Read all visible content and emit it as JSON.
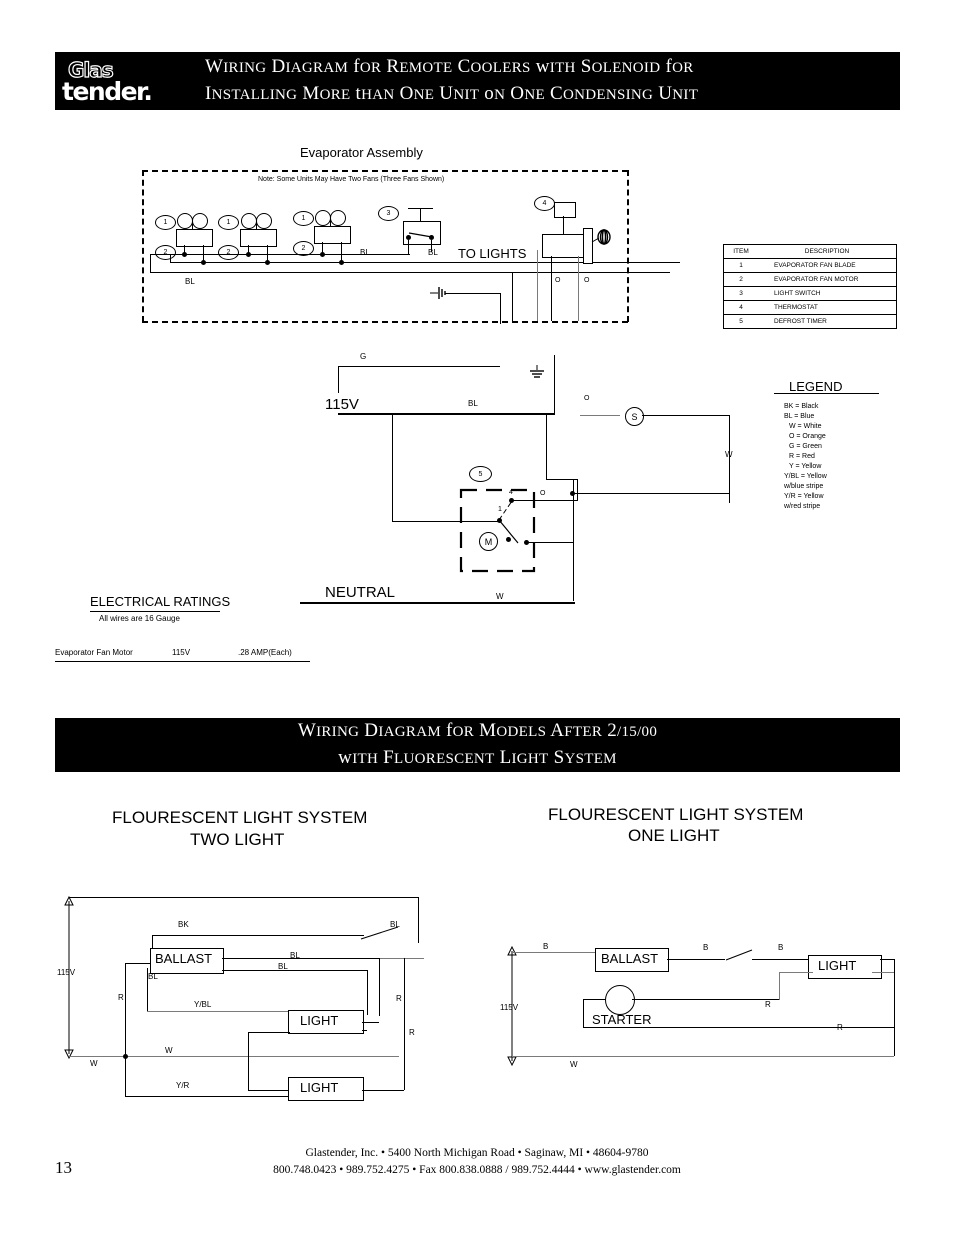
{
  "page": {
    "number": "13"
  },
  "header": {
    "logo_top": "Glas",
    "logo_bottom": "tender.",
    "title_line1": "Wiring Diagram for Remote Coolers with Solenoid for",
    "title_line2": "Installing More than One Unit on One Condensing Unit"
  },
  "banner2": {
    "title_line1": "Wiring Diagram for Models After 2/15/00",
    "title_line2": "with Fluorescent Light System"
  },
  "evaporator": {
    "title": "Evaporator Assembly",
    "note": "Note: Some Units May Have Two Fans (Three Fans Shown)",
    "fan_callouts": [
      "1",
      "2",
      "1",
      "2",
      "1",
      "2"
    ],
    "switch_callout": "3",
    "thermostat_callout": "4",
    "timer_callout": "5",
    "labels": {
      "bl_switch_left": "BL",
      "bl_switch_right": "BL",
      "to_lights": "TO LIGHTS",
      "bl_bus": "BL",
      "o_left": "O",
      "o_right": "O",
      "g_ground": "G",
      "bl_main": "BL",
      "o_mid": "O",
      "o_timer": "O",
      "w_right": "W",
      "w_neutral": "W",
      "supply_115v": "115V",
      "neutral": "NEUTRAL",
      "solenoid": "S",
      "timer_motor": "M",
      "timer_term_1": "1",
      "timer_term_4": "4"
    }
  },
  "item_table": {
    "headers": [
      "ITEM",
      "DESCRIPTION"
    ],
    "rows": [
      {
        "item": "1",
        "description": "EVAPORATOR FAN BLADE"
      },
      {
        "item": "2",
        "description": "EVAPORATOR FAN MOTOR"
      },
      {
        "item": "3",
        "description": "LIGHT SWITCH"
      },
      {
        "item": "4",
        "description": "THERMOSTAT"
      },
      {
        "item": "5",
        "description": "DEFROST TIMER"
      }
    ]
  },
  "legend": {
    "title": "LEGEND",
    "entries": [
      "BK = Black",
      "BL = Blue",
      "W = White",
      "O = Orange",
      "G = Green",
      "R = Red",
      "Y = Yellow",
      "Y/BL = Yellow",
      "w/blue stripe",
      "Y/R = Yellow",
      "w/red stripe"
    ]
  },
  "electrical_ratings": {
    "title": "ELECTRICAL RATINGS",
    "subtitle": "All wires are 16 Gauge",
    "rows": [
      {
        "component": "Evaporator Fan Motor",
        "voltage": "115V",
        "current": ".28 AMP(Each)"
      }
    ]
  },
  "fluorescent_two": {
    "title_line1": "FLOURESCENT LIGHT SYSTEM",
    "title_line2": "TWO LIGHT",
    "labels": {
      "supply": "115V",
      "bk": "BK",
      "bl_switch": "BL",
      "ballast": "BALLAST",
      "bl_top": "BL",
      "bl_second": "BL",
      "bl_left": "BL",
      "y_bl": "Y/BL",
      "y_r": "Y/R",
      "r_left": "R",
      "r_mid": "R",
      "r_right": "R",
      "w_left": "W",
      "w_mid": "W",
      "light_top": "LIGHT",
      "light_bottom": "LIGHT"
    }
  },
  "fluorescent_one": {
    "title_line1": "FLOURESCENT LIGHT SYSTEM",
    "title_line2": "ONE LIGHT",
    "labels": {
      "supply": "115V",
      "b_left": "B",
      "b_mid": "B",
      "b_right": "B",
      "ballast": "BALLAST",
      "starter": "STARTER",
      "light": "LIGHT",
      "r_mid": "R",
      "r_bottom": "R",
      "w": "W"
    }
  },
  "footer": {
    "line1": "Glastender, Inc.  •  5400 North Michigan Road •  Saginaw, MI  •  48604-9780",
    "line2": "800.748.0423  •  989.752.4275  •  Fax 800.838.0888 / 989.752.4444  •  www.glastender.com"
  }
}
